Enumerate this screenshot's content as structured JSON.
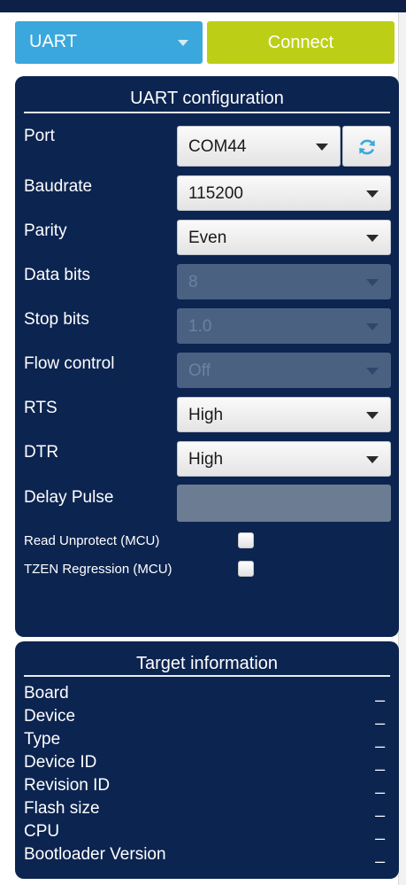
{
  "interface": {
    "selected": "UART",
    "connect_label": "Connect"
  },
  "uart_config": {
    "title": "UART configuration",
    "port": {
      "label": "Port",
      "value": "COM44"
    },
    "baudrate": {
      "label": "Baudrate",
      "value": "115200"
    },
    "parity": {
      "label": "Parity",
      "value": "Even"
    },
    "data_bits": {
      "label": "Data bits",
      "value": "8"
    },
    "stop_bits": {
      "label": "Stop bits",
      "value": "1.0"
    },
    "flow_control": {
      "label": "Flow control",
      "value": "Off"
    },
    "rts": {
      "label": "RTS",
      "value": "High"
    },
    "dtr": {
      "label": "DTR",
      "value": "High"
    },
    "delay_pulse": {
      "label": "Delay Pulse",
      "value": ""
    },
    "read_unprotect": {
      "label": "Read Unprotect (MCU)",
      "checked": false
    },
    "tzen_regression": {
      "label": "TZEN Regression (MCU)",
      "checked": false
    }
  },
  "target_info": {
    "title": "Target information",
    "rows": [
      {
        "label": "Board",
        "value": "_"
      },
      {
        "label": "Device",
        "value": "_"
      },
      {
        "label": "Type",
        "value": "_"
      },
      {
        "label": "Device ID",
        "value": "_"
      },
      {
        "label": "Revision ID",
        "value": "_"
      },
      {
        "label": "Flash size",
        "value": "_"
      },
      {
        "label": "CPU",
        "value": "_"
      },
      {
        "label": "Bootloader Version",
        "value": "_"
      }
    ]
  },
  "icons": {
    "refresh": "refresh-icon",
    "dropdown": "chevron-down-icon"
  },
  "colors": {
    "panel": "#0c2450",
    "interface_select": "#3aa8dc",
    "connect": "#bccf16",
    "refresh_icon": "#3aa8dc"
  }
}
